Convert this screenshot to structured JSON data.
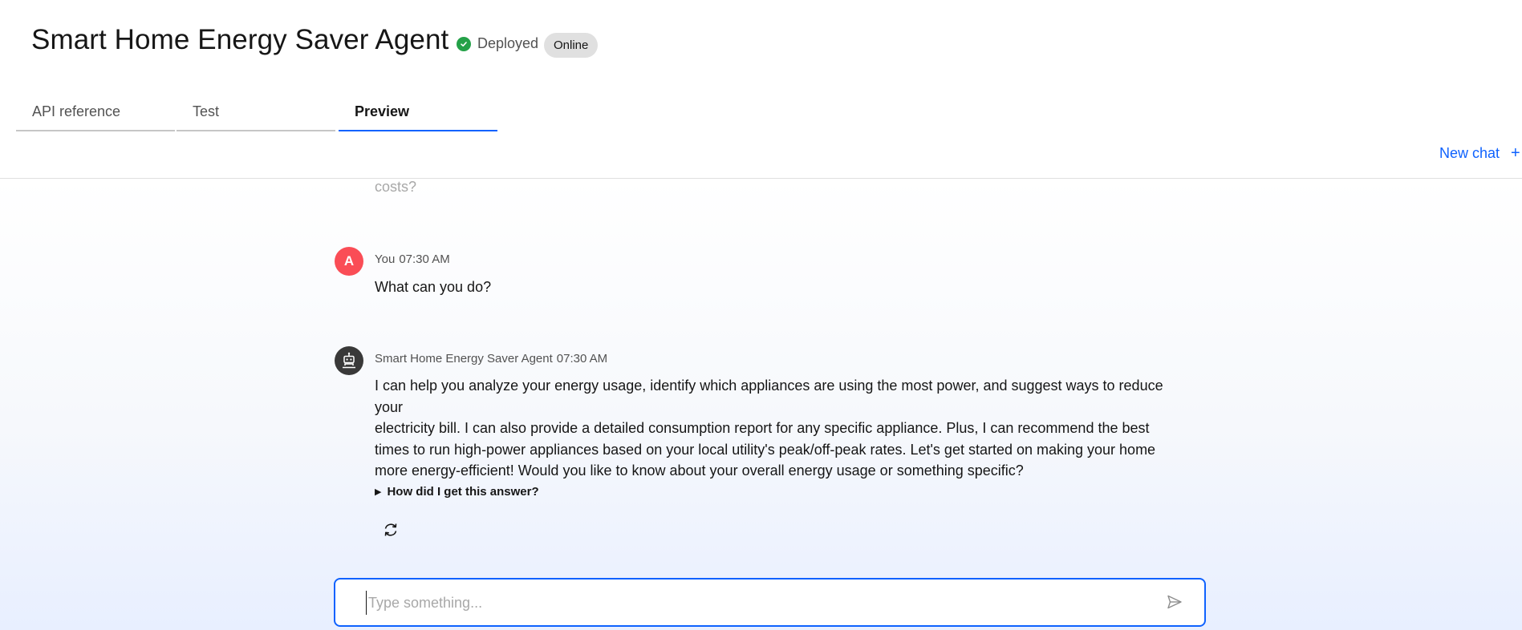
{
  "header": {
    "title": "Smart Home Energy Saver Agent",
    "status_label": "Deployed",
    "badge": "Online",
    "status_color": "#24a148"
  },
  "tabs": [
    {
      "label": "API reference",
      "active": false
    },
    {
      "label": "Test",
      "active": false
    },
    {
      "label": "Preview",
      "active": true
    }
  ],
  "toolbar": {
    "new_chat_label": "New chat",
    "new_chat_icon": "+"
  },
  "conversation": {
    "previous_fragment": "costs?",
    "messages": [
      {
        "avatar": "A",
        "sender": "You",
        "time": "07:30 AM",
        "text": "What can you do?"
      },
      {
        "avatar_icon": "robot-icon",
        "sender": "Smart Home Energy Saver Agent",
        "time": "07:30 AM",
        "lines": [
          "I can help you analyze your energy usage, identify which appliances are using the most power, and suggest ways to reduce your",
          "electricity bill. I can also provide a detailed consumption report for any specific appliance. Plus, I can recommend the best",
          "times to run high-power appliances based on your local utility's peak/off-peak rates. Let's get started on making your home",
          "more energy-efficient! Would you like to know about your overall energy usage or something specific?"
        ]
      }
    ],
    "explain_label": "How did I get this answer?"
  },
  "input": {
    "placeholder": "Type something...",
    "value": ""
  },
  "colors": {
    "accent": "#0f62fe",
    "user_avatar": "#fa4d56",
    "bot_avatar": "#393939"
  }
}
